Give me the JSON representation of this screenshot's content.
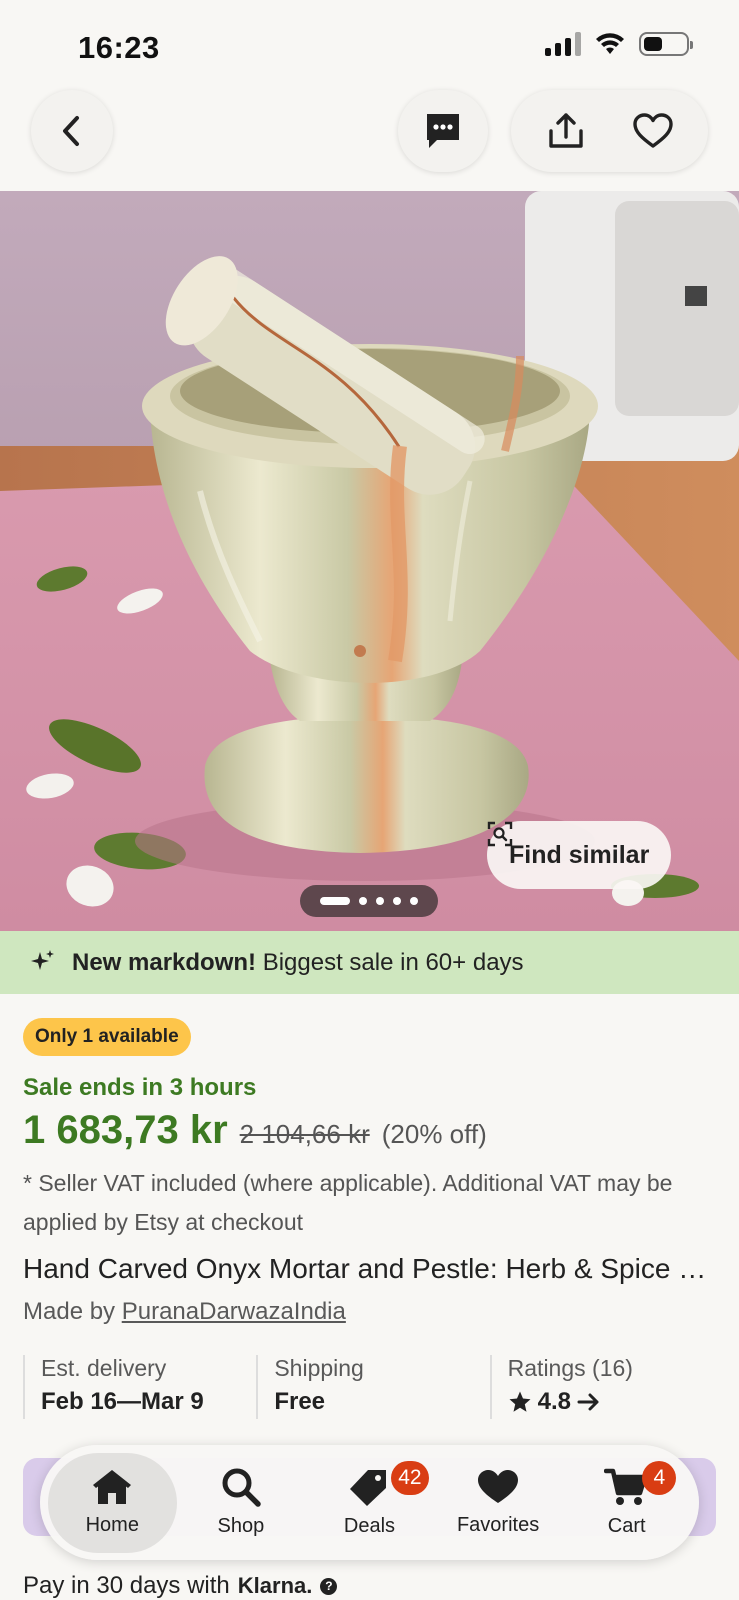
{
  "status_bar": {
    "time": "16:23",
    "battery_level": 0.46
  },
  "nav": {
    "back_icon": "chevron-left-icon",
    "message_icon": "message-icon",
    "share_icon": "share-icon",
    "favorite_icon": "heart-icon"
  },
  "hero": {
    "find_similar_label": "Find similar",
    "image_count": 5,
    "active_image": 1
  },
  "banner": {
    "bold": "New markdown!",
    "text": " Biggest sale in 60+ days",
    "color": "#cfe7bf"
  },
  "product": {
    "availability_badge": "Only 1 available",
    "sale_ends": "Sale ends in 3 hours",
    "price": "1 683,73 kr",
    "original_price": "2 104,66 kr",
    "discount": "(20% off)",
    "vat_note": "* Seller VAT included (where applicable). Additional VAT may be applied by Etsy at checkout",
    "title": "Hand Carved Onyx Mortar and Pestle: Herb & Spice Grinder",
    "made_by_prefix": "Made by ",
    "shop_name": "PuranaDarwazaIndia",
    "sale_color": "#3d7a22"
  },
  "info": {
    "delivery_label": "Est. delivery",
    "delivery_value": "Feb 16—Mar 9",
    "shipping_label": "Shipping",
    "shipping_value": "Free",
    "ratings_label": "Ratings (16)",
    "ratings_value": "4.8"
  },
  "tabs": [
    {
      "label": "Home",
      "icon": "home-icon",
      "active": true
    },
    {
      "label": "Shop",
      "icon": "search-icon"
    },
    {
      "label": "Deals",
      "icon": "tag-icon",
      "badge": "42"
    },
    {
      "label": "Favorites",
      "icon": "heart-icon"
    },
    {
      "label": "Cart",
      "icon": "cart-icon",
      "badge": "4"
    }
  ],
  "klarna": {
    "text": "Pay in 30 days with",
    "brand": "Klarna."
  }
}
